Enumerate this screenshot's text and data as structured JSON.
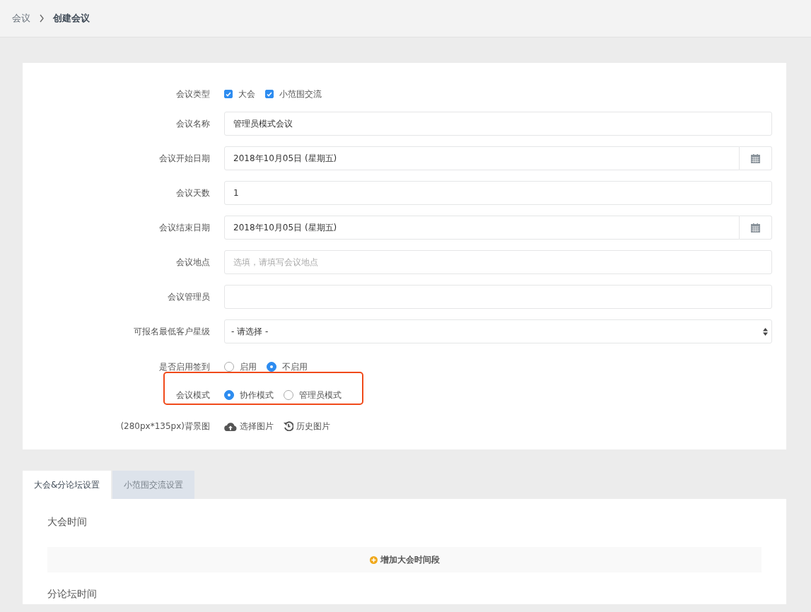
{
  "breadcrumb": [
    {
      "label": "会议",
      "current": false
    },
    {
      "label": "创建会议",
      "current": true
    }
  ],
  "form": [
    {
      "kind": "checks",
      "label": "会议类型",
      "options": [
        {
          "label": "大会",
          "checked": true
        },
        {
          "label": "小范围交流",
          "checked": true
        }
      ]
    },
    {
      "kind": "text",
      "label": "会议名称",
      "value": "管理员模式会议"
    },
    {
      "kind": "date",
      "label": "会议开始日期",
      "value": "2018年10月05日 (星期五)"
    },
    {
      "kind": "text",
      "label": "会议天数",
      "value": "1"
    },
    {
      "kind": "date",
      "label": "会议结束日期",
      "value": "2018年10月05日 (星期五)"
    },
    {
      "kind": "text",
      "label": "会议地点",
      "placeholder": "选填，请填写会议地点"
    },
    {
      "kind": "text",
      "label": "会议管理员"
    },
    {
      "kind": "select",
      "label": "可报名最低客户星级",
      "value": "- 请选择 -"
    },
    {
      "kind": "radios",
      "label": "是否启用签到",
      "highlighted": false,
      "options": [
        {
          "label": "启用",
          "selected": false
        },
        {
          "label": "不启用",
          "selected": true
        }
      ]
    },
    {
      "kind": "radios",
      "label": "会议模式",
      "highlighted": true,
      "options": [
        {
          "label": "协作模式",
          "selected": true
        },
        {
          "label": "管理员模式",
          "selected": false
        }
      ]
    },
    {
      "kind": "upload",
      "label": "(280px*135px)背景图",
      "actions": [
        {
          "label": "选择图片"
        },
        {
          "label": "历史图片"
        }
      ]
    }
  ],
  "tabs": [
    {
      "label": "大会&分论坛设置",
      "selected": true
    },
    {
      "label": "小范围交流设置",
      "selected": false
    }
  ],
  "panel": {
    "sections": [
      {
        "title": "大会时间",
        "add_button": "增加大会时间段"
      },
      {
        "title": "分论坛时间"
      }
    ]
  }
}
